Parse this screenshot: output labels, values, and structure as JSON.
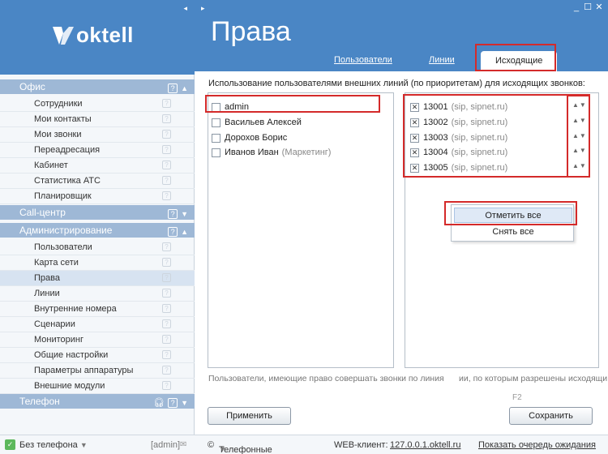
{
  "brand": {
    "logo_text": "oktell",
    "collapse_glyph": "◂"
  },
  "sidebar": {
    "sections": [
      {
        "label": "Офис",
        "icon": "help-icon",
        "state": "expanded"
      },
      {
        "label": "Call-центр",
        "icon": "help-icon",
        "state": "collapsed"
      },
      {
        "label": "Администрирование",
        "icon": "help-icon",
        "state": "expanded"
      },
      {
        "label": "Телефон",
        "icon": "headset-icon",
        "state": "collapsed"
      }
    ],
    "office_items": [
      "Сотрудники",
      "Мои контакты",
      "Мои звонки",
      "Переадресация",
      "Кабинет",
      "Статистика АТС",
      "Планировщик"
    ],
    "admin_items": [
      "Пользователи",
      "Карта сети",
      "Права",
      "Линии",
      "Внутренние номера",
      "Сценарии",
      "Мониторинг",
      "Общие настройки",
      "Параметры аппаратуры",
      "Внешние модули"
    ],
    "selected_item": "Права",
    "footer": {
      "phone_status": "Без телефона",
      "user": "[admin]"
    }
  },
  "header": {
    "title": "Права",
    "tabs": [
      {
        "label": "Пользователи",
        "active": false
      },
      {
        "label": "Линии",
        "active": false
      },
      {
        "label": "Исходящие",
        "active": true
      }
    ]
  },
  "content": {
    "description": "Использование пользователями внешних линий (по приоритетам) для исходящих звонков:",
    "users": [
      {
        "name": "admin",
        "group": "",
        "checked": false
      },
      {
        "name": "Васильев Алексей",
        "group": "",
        "checked": false
      },
      {
        "name": "Дорохов Борис",
        "group": "",
        "checked": false
      },
      {
        "name": "Иванов Иван",
        "group": "(Маркетинг)",
        "checked": false
      }
    ],
    "lines": [
      {
        "number": "13001",
        "info": "(sip, sipnet.ru)",
        "checked": true
      },
      {
        "number": "13002",
        "info": "(sip, sipnet.ru)",
        "checked": true
      },
      {
        "number": "13003",
        "info": "(sip, sipnet.ru)",
        "checked": true
      },
      {
        "number": "13004",
        "info": "(sip, sipnet.ru)",
        "checked": true
      },
      {
        "number": "13005",
        "info": "(sip, sipnet.ru)",
        "checked": true
      }
    ],
    "context_menu": {
      "select_all": "Отметить все",
      "deselect_all": "Снять все"
    },
    "hint_left": "Пользователи, имеющие право совершать звонки по линиям",
    "hint_right": "ии, по которым разрешены исходящи",
    "shortcut": "F2",
    "apply_button": "Применить",
    "save_button": "Сохранить"
  },
  "status_bar": {
    "copyright": "©",
    "company": "Телефонные системы",
    "web_client_label": "WEB-клиент:",
    "web_client_url": "127.0.0.1.oktell.ru",
    "queue_link": "Показать очередь ожидания"
  },
  "colors": {
    "brand_blue": "#4a86c5",
    "section_bg": "#9eb8d6",
    "highlight_red": "#d42a2a"
  }
}
